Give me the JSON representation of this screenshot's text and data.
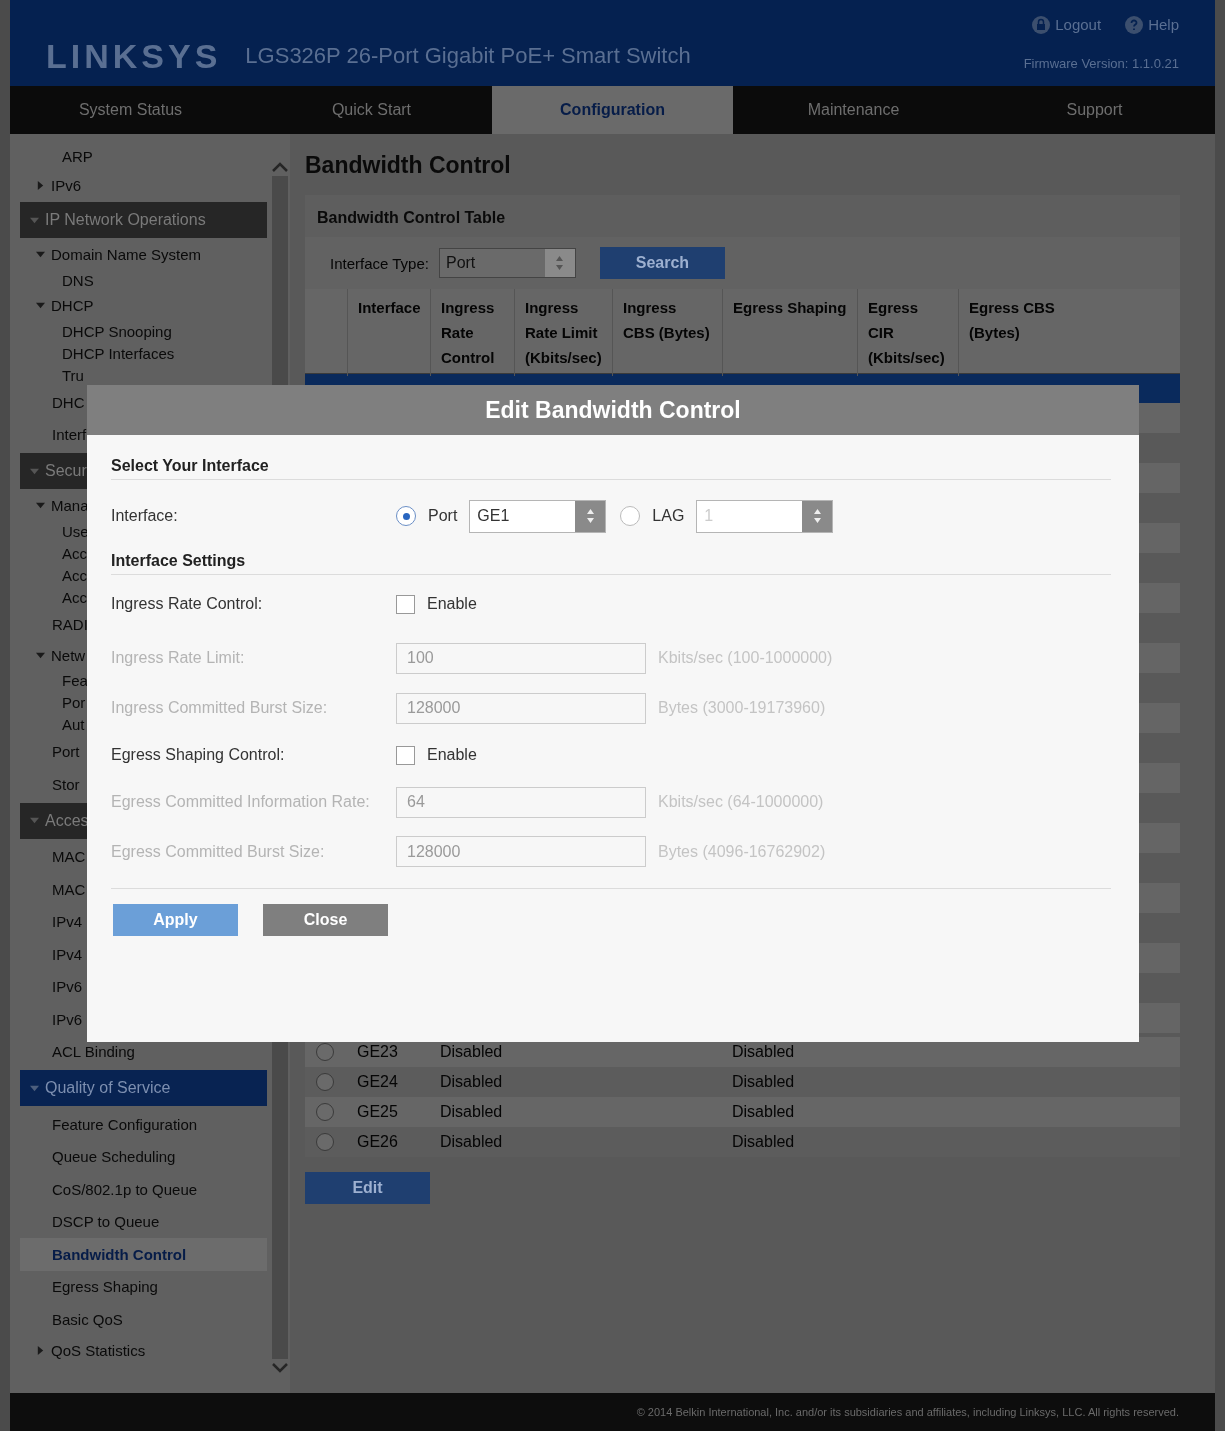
{
  "header": {
    "logo": "LINKSYS",
    "product": "LGS326P 26-Port Gigabit PoE+ Smart Switch",
    "links": [
      {
        "label": "Logout",
        "kind": "lock"
      },
      {
        "label": "Help",
        "kind": "help"
      }
    ],
    "firmware": "Firmware Version: 1.1.0.21"
  },
  "nav": [
    {
      "label": "System Status",
      "selected": false
    },
    {
      "label": "Quick Start",
      "selected": false
    },
    {
      "label": "Configuration",
      "selected": true
    },
    {
      "label": "Maintenance",
      "selected": false
    },
    {
      "label": "Support",
      "selected": false
    }
  ],
  "sidebar": {
    "items": [
      {
        "kind": "sublink",
        "label": "ARP",
        "selected": false
      },
      {
        "kind": "group",
        "label": "IPv6",
        "expanded": false
      },
      {
        "kind": "section",
        "label": "IP Network Operations",
        "selected": false,
        "children": [
          {
            "kind": "group",
            "label": "Domain Name System",
            "expanded": true,
            "children": [
              {
                "label": "DNS",
                "selected": false
              }
            ]
          },
          {
            "kind": "group",
            "label": "DHCP",
            "expanded": true,
            "children": [
              {
                "label": "DHCP Snooping",
                "selected": false
              },
              {
                "label": "DHCP Interfaces",
                "selected": false
              },
              {
                "label": "Tru",
                "selected": false
              }
            ]
          },
          {
            "kind": "link",
            "label": "DHC",
            "selected": false
          },
          {
            "kind": "link",
            "label": "Interf",
            "selected": false
          }
        ]
      },
      {
        "kind": "section",
        "label": "Secur",
        "selected": false,
        "children": [
          {
            "kind": "group",
            "label": "Mana",
            "expanded": true,
            "children": [
              {
                "label": "Use",
                "selected": false
              },
              {
                "label": "Acc",
                "selected": false
              },
              {
                "label": "Acc",
                "selected": false
              },
              {
                "label": "Acc",
                "selected": false
              }
            ]
          },
          {
            "kind": "link",
            "label": "RADI",
            "selected": false
          },
          {
            "kind": "group",
            "label": "Netw",
            "expanded": true,
            "children": [
              {
                "label": "Fea",
                "selected": false
              },
              {
                "label": "Por",
                "selected": false
              },
              {
                "label": "Aut",
                "selected": false
              }
            ]
          },
          {
            "kind": "link",
            "label": "Port",
            "selected": false
          },
          {
            "kind": "link",
            "label": "Stor",
            "selected": false
          }
        ]
      },
      {
        "kind": "section",
        "label": "Acces",
        "selected": false,
        "children": [
          {
            "kind": "link",
            "label": "MAC",
            "selected": false
          },
          {
            "kind": "link",
            "label": "MAC",
            "selected": false
          },
          {
            "kind": "link",
            "label": "IPv4",
            "selected": false
          },
          {
            "kind": "link",
            "label": "IPv4",
            "selected": false
          },
          {
            "kind": "link",
            "label": "IPv6",
            "selected": false
          },
          {
            "kind": "link",
            "label": "IPv6",
            "selected": false
          },
          {
            "kind": "link",
            "label": "ACL Binding",
            "selected": false
          }
        ]
      },
      {
        "kind": "section",
        "label": "Quality of Service",
        "selected": true,
        "children": [
          {
            "kind": "link",
            "label": "Feature Configuration",
            "selected": false
          },
          {
            "kind": "link",
            "label": "Queue Scheduling",
            "selected": false
          },
          {
            "kind": "link",
            "label": "CoS/802.1p to Queue",
            "selected": false
          },
          {
            "kind": "link",
            "label": "DSCP to Queue",
            "selected": false
          },
          {
            "kind": "link",
            "label": "Bandwidth Control",
            "selected": true
          },
          {
            "kind": "link",
            "label": "Egress Shaping",
            "selected": false
          },
          {
            "kind": "link",
            "label": "Basic QoS",
            "selected": false
          },
          {
            "kind": "group",
            "label": "QoS Statistics",
            "expanded": false
          }
        ]
      }
    ]
  },
  "page_title": "Bandwidth Control",
  "table_panel": {
    "title": "Bandwidth Control Table",
    "filter_label": "Interface Type:",
    "filter_value": "Port",
    "search_button": "Search",
    "columns": [
      "Interface",
      "Ingress Rate Control",
      "Ingress Rate Limit (Kbits/sec)",
      "Ingress CBS (Bytes)",
      "Egress Shaping",
      "Egress CIR (Kbits/sec)",
      "Egress CBS (Bytes)"
    ],
    "rows": [
      {
        "selected": false,
        "interface": "GE23",
        "ingress_rate_control": "Disabled",
        "egress_shaping": "Disabled"
      },
      {
        "selected": false,
        "interface": "GE24",
        "ingress_rate_control": "Disabled",
        "egress_shaping": "Disabled"
      },
      {
        "selected": false,
        "interface": "GE25",
        "ingress_rate_control": "Disabled",
        "egress_shaping": "Disabled"
      },
      {
        "selected": false,
        "interface": "GE26",
        "ingress_rate_control": "Disabled",
        "egress_shaping": "Disabled"
      }
    ],
    "edit_button": "Edit"
  },
  "dialog": {
    "title": "Edit Bandwidth Control",
    "section_1": "Select Your Interface",
    "interface_label": "Interface:",
    "interface_options": [
      {
        "label": "Port",
        "selected": true,
        "value": "GE1"
      },
      {
        "label": "LAG",
        "selected": false,
        "value": "1"
      }
    ],
    "section_2": "Interface Settings",
    "fields": [
      {
        "kind": "checkbox",
        "label": "Ingress Rate Control:",
        "text": "Enable",
        "checked": false,
        "disabled": false
      },
      {
        "kind": "input",
        "label": "Ingress Rate Limit:",
        "value": "100",
        "hint": "Kbits/sec (100-1000000)",
        "disabled": true
      },
      {
        "kind": "input",
        "label": "Ingress Committed Burst Size:",
        "value": "128000",
        "hint": "Bytes (3000-19173960)",
        "disabled": true
      },
      {
        "kind": "checkbox",
        "label": "Egress Shaping Control:",
        "text": "Enable",
        "checked": false,
        "disabled": false
      },
      {
        "kind": "input",
        "label": "Egress Committed Information Rate:",
        "value": "64",
        "hint": "Kbits/sec (64-1000000)",
        "disabled": true
      },
      {
        "kind": "input",
        "label": "Egress Committed Burst Size:",
        "value": "128000",
        "hint": "Bytes (4096-16762902)",
        "disabled": true
      }
    ],
    "buttons": [
      {
        "label": "Apply",
        "kind": "primary"
      },
      {
        "label": "Close",
        "kind": "secondary"
      }
    ]
  },
  "footer": "© 2014 Belkin International, Inc. and/or its subsidiaries and affiliates, including Linksys, LLC. All rights reserved."
}
